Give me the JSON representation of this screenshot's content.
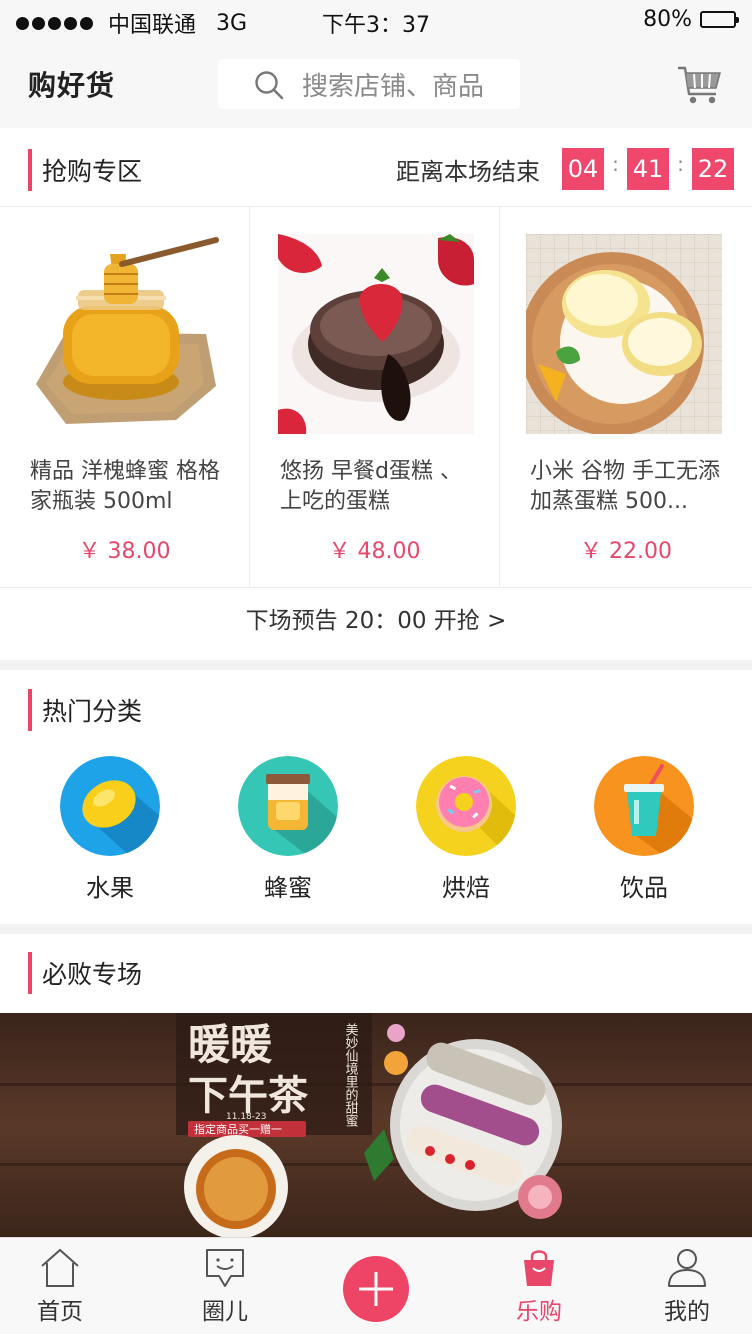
{
  "status_bar": {
    "signal_dots": 5,
    "carrier": "中国联通",
    "network": "3G",
    "time": "下午3：37",
    "battery": "80%",
    "battery_level": 0.8
  },
  "header": {
    "app_title": "购好货",
    "search_placeholder": "搜索店铺、商品",
    "icons": {
      "search": "search-icon",
      "cart": "cart-icon"
    }
  },
  "flash_sale": {
    "title": "抢购专区",
    "countdown_label": "距离本场结束",
    "countdown": [
      "04",
      "41",
      "22"
    ],
    "products": [
      {
        "name": "精品 洋槐蜂蜜  格格家瓶装 500ml",
        "price": "￥ 38.00",
        "image": "honey-jar"
      },
      {
        "name": "悠扬 早餐d蛋糕 、上吃的蛋糕",
        "price": "￥ 48.00",
        "image": "lava-cake"
      },
      {
        "name": "小米 谷物 手工无添加蒸蛋糕 500...",
        "price": "￥ 22.00",
        "image": "swiss-roll"
      }
    ],
    "next_preview": "下场预告 20：00 开抢 >"
  },
  "categories": {
    "title": "热门分类",
    "items": [
      {
        "label": "水果",
        "icon": "lemon-icon",
        "color": "#1fa3e8"
      },
      {
        "label": "蜂蜜",
        "icon": "honey-jar-icon",
        "color": "#36c6b5"
      },
      {
        "label": "烘焙",
        "icon": "donut-icon",
        "color": "#f5d21d"
      },
      {
        "label": "饮品",
        "icon": "drink-cup-icon",
        "color": "#f7931e"
      }
    ]
  },
  "must_buy": {
    "title": "必败专场",
    "banner": {
      "headline_1": "暖暖",
      "headline_2": "下午茶",
      "side_text": "美妙仙境里的甜蜜",
      "date": "11.18-23",
      "promo": "指定商品买一赠一"
    }
  },
  "tab_bar": {
    "tabs": [
      {
        "label": "首页",
        "icon": "home-icon"
      },
      {
        "label": "圈儿",
        "icon": "chat-icon"
      },
      {
        "label": "",
        "icon": "plus-icon"
      },
      {
        "label": "乐购",
        "icon": "shopping-bag-icon",
        "active": true
      },
      {
        "label": "我的",
        "icon": "user-icon"
      }
    ]
  },
  "colors": {
    "accent": "#e8476a",
    "countdown_bg": "#f0476c",
    "price": "#e8476a",
    "battery": "#3cd12d"
  }
}
